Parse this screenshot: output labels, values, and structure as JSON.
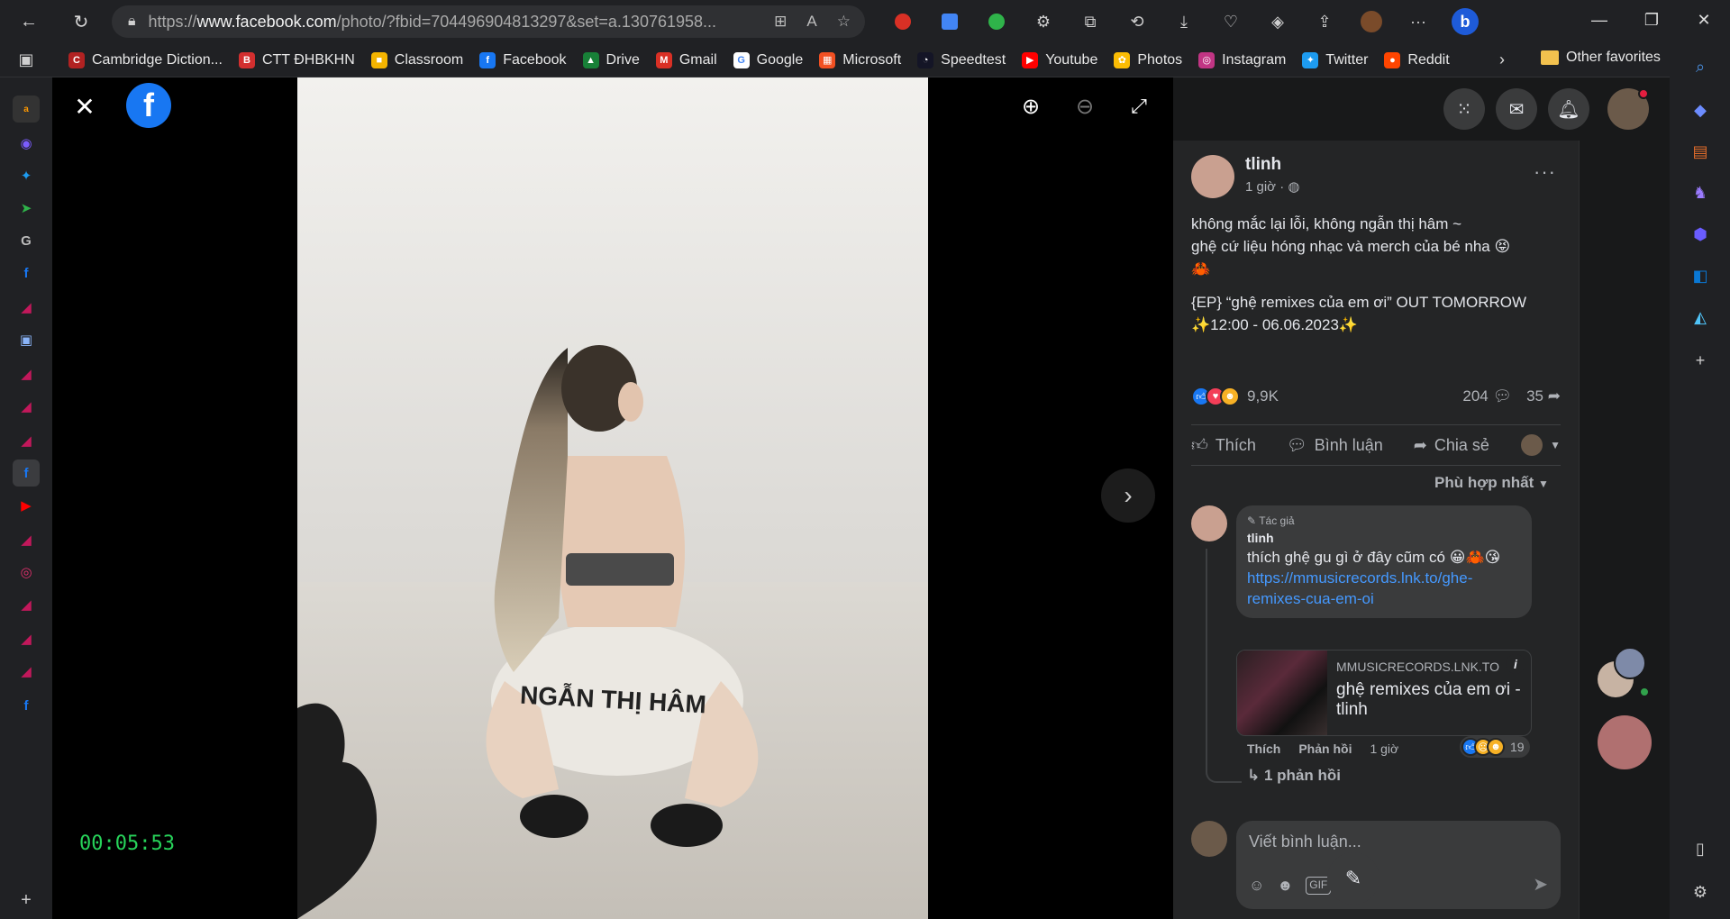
{
  "browser": {
    "url_prefix": "https://",
    "url_domain": "www.facebook.com",
    "url_rest": "/photo/?fbid=704496904813297&set=a.130761958...",
    "nav": {
      "back": "←",
      "reload": "↻"
    },
    "window": {
      "minimize": "—",
      "maximize": "❐",
      "close": "✕"
    }
  },
  "favorites": [
    {
      "label": "Cambridge Diction...",
      "color": "#b22222",
      "glyph": "C"
    },
    {
      "label": "CTT ĐHBKHN",
      "color": "#d32f2f",
      "glyph": "B"
    },
    {
      "label": "Classroom",
      "color": "#f4b400",
      "glyph": "■"
    },
    {
      "label": "Facebook",
      "color": "#1877f2",
      "glyph": "f"
    },
    {
      "label": "Drive",
      "color": "#188038",
      "glyph": "▲"
    },
    {
      "label": "Gmail",
      "color": "#d93025",
      "glyph": "M"
    },
    {
      "label": "Google",
      "color": "#ffffff",
      "glyph": "G"
    },
    {
      "label": "Microsoft",
      "color": "#f25022",
      "glyph": "▦"
    },
    {
      "label": "Speedtest",
      "color": "#141526",
      "glyph": "◔"
    },
    {
      "label": "Youtube",
      "color": "#ff0000",
      "glyph": "▶"
    },
    {
      "label": "Photos",
      "color": "#fbbc04",
      "glyph": "✿"
    },
    {
      "label": "Instagram",
      "color": "#c13584",
      "glyph": "◎"
    },
    {
      "label": "Twitter",
      "color": "#1d9bf0",
      "glyph": "✦"
    },
    {
      "label": "Reddit",
      "color": "#ff4500",
      "glyph": "●"
    }
  ],
  "other_favorites": "Other favorites",
  "viewer": {
    "timer": "00:05:53",
    "photo_text": "NGẪN THỊ HÂM"
  },
  "post": {
    "author": "tlinh",
    "time": "1 giờ ·",
    "text_lines": [
      "không mắc lại lỗi, không ngẫn thị hâm ~",
      "ghệ cứ liệu hóng nhạc và merch của bé nha 😝",
      "🦀",
      "",
      "{EP} “ghệ remixes của em ơi” OUT TOMORROW",
      "✨12:00 - 06.06.2023✨"
    ],
    "reaction_count": "9,9K",
    "comment_count": "204",
    "share_count": "35",
    "actions": {
      "like": "Thích",
      "comment": "Bình luận",
      "share": "Chia sẻ"
    },
    "sort_label": "Phù hợp nhất"
  },
  "comment": {
    "badge": "Tác giả",
    "author": "tlinh",
    "text": "thích ghệ gu gì ở đây cũm có 😀🦀😘",
    "link": "https://mmusicrecords.lnk.to/ghe-remixes-cua-em-oi",
    "card_domain": "MMUSICRECORDS.LNK.TO",
    "card_title": "ghệ remixes của em ơi - tlinh",
    "like": "Thích",
    "reply": "Phản hồi",
    "time": "1 giờ",
    "reactions": "19",
    "replies_label": "1 phản hồi"
  },
  "compose": {
    "placeholder": "Viết bình luận..."
  },
  "colors": {
    "fb_blue": "#1877f2",
    "panel_bg": "#242526",
    "bubble_bg": "#3a3b3c",
    "link_blue": "#4599ff",
    "timer_green": "#27d35a"
  }
}
